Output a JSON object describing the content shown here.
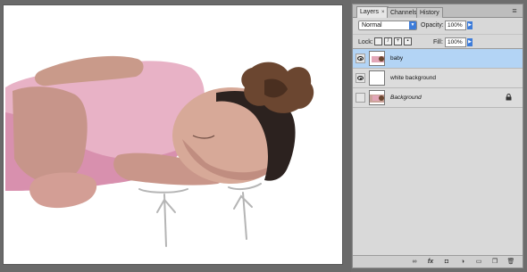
{
  "panel": {
    "tabs": [
      {
        "label": "Layers",
        "close": "×"
      },
      {
        "label": "Channels"
      },
      {
        "label": "History"
      }
    ],
    "blend_mode": "Normal",
    "opacity_label": "Opacity:",
    "opacity_value": "100%",
    "lock_label": "Lock:",
    "fill_label": "Fill:",
    "fill_value": "100%"
  },
  "layers": [
    {
      "name": "baby",
      "visible": true,
      "selected": true,
      "locked": false
    },
    {
      "name": "white background",
      "visible": true,
      "selected": false,
      "locked": false
    },
    {
      "name": "Background",
      "visible": false,
      "selected": false,
      "locked": true
    }
  ],
  "footer_icons": [
    "link-icon",
    "fx-icon",
    "mask-icon",
    "adjustment-icon",
    "folder-icon",
    "new-layer-icon",
    "trash-icon"
  ],
  "colors": {
    "selection": "#b3d4f5",
    "accent": "#3d7cd9"
  }
}
